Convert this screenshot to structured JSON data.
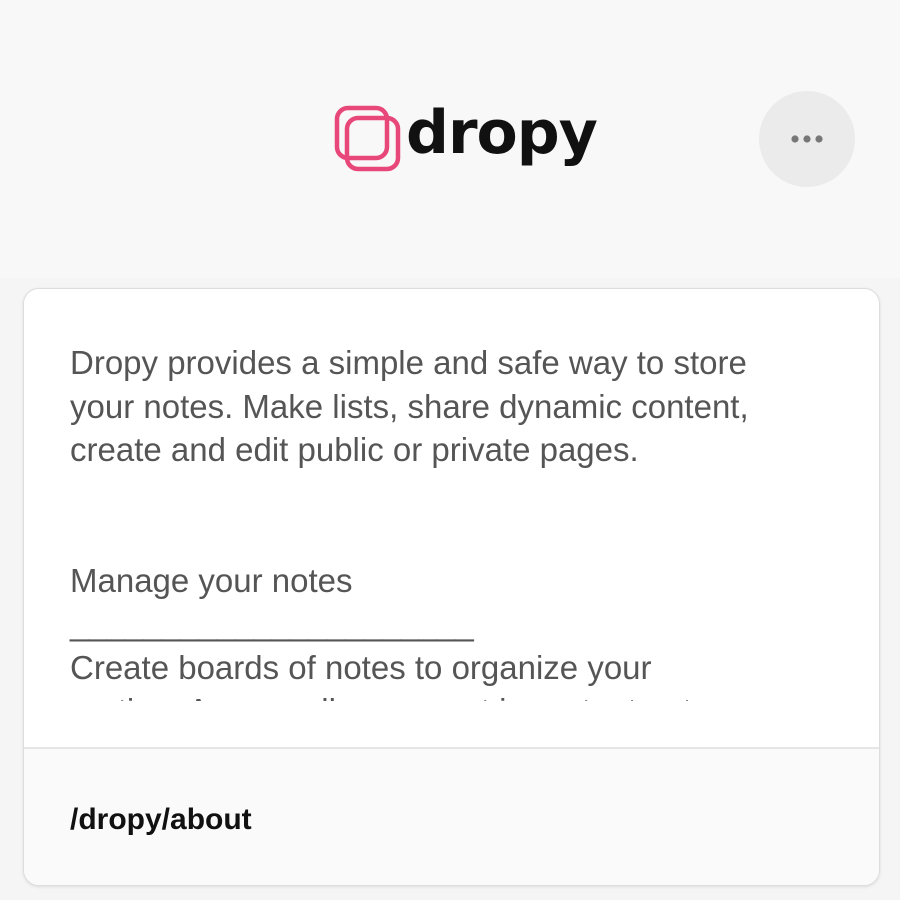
{
  "header": {
    "brand_name": "dropy",
    "brand_color": "#e8477a",
    "menu_icon": "more-horizontal-icon"
  },
  "card": {
    "paragraphs": [
      "Dropy provides a simple and safe way to store\nyour notes. Make lists, share dynamic content,\ncreate and edit public or private pages.",
      "Manage your notes\n______________________\nCreate boards of notes to organize your\nroutine. Access all your most important notes"
    ],
    "footer_path": "/dropy/about"
  }
}
